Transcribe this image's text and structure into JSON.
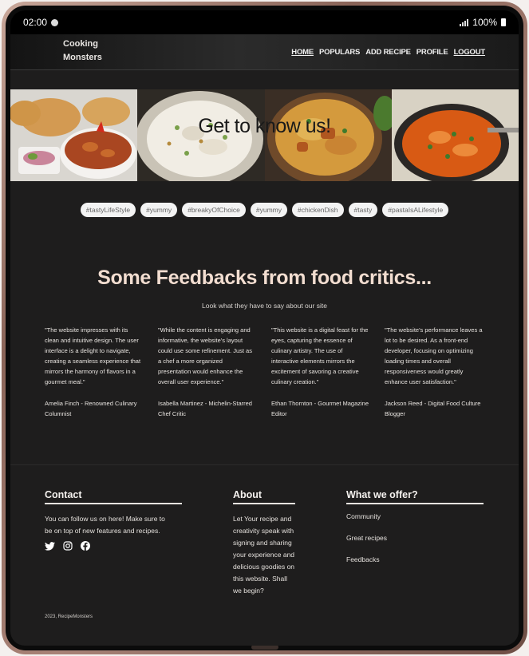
{
  "status": {
    "time": "02:00",
    "battery": "100%"
  },
  "brand": {
    "line1": "Cooking",
    "line2": "Monsters"
  },
  "nav": [
    {
      "label": "HOME"
    },
    {
      "label": "POPULARS"
    },
    {
      "label": "ADD RECIPE"
    },
    {
      "label": "PROFILE"
    },
    {
      "label": "LOGOUT"
    }
  ],
  "banner": {
    "title": "Get to know us!"
  },
  "tags": [
    "#tastyLifeStyle",
    "#yummy",
    "#breakyOfChoice",
    "#yummy",
    "#chickenDish",
    "#tasty",
    "#pastaIsALifestyle"
  ],
  "feedback": {
    "title": "Some Feedbacks from food critics...",
    "subtitle": "Look what they have to say about our site",
    "reviews": [
      {
        "quote": "\"The website impresses with its clean and intuitive design. The user interface is a delight to navigate, creating a seamless experience that mirrors the harmony of flavors in a gourmet meal.\"",
        "author": "Amelia Finch - Renowned Culinary Columnist"
      },
      {
        "quote": "\"While the content is engaging and informative, the website's layout could use some refinement. Just as a chef a more organized presentation would enhance the overall user experience.\"",
        "author": "Isabella Martinez - Michelin-Starred Chef Critic"
      },
      {
        "quote": "\"This website is a digital feast for the eyes, capturing the essence of culinary artistry. The use of interactive elements mirrors the excitement of savoring a creative culinary creation.\"",
        "author": "Ethan Thornton - Gourmet Magazine Editor"
      },
      {
        "quote": "\"The website's performance leaves a lot to be desired. As a front-end developer, focusing on optimizing loading times and overall responsiveness would greatly enhance user satisfaction.\"",
        "author": "Jackson Reed - Digital Food Culture Blogger"
      }
    ]
  },
  "footer": {
    "contact": {
      "title": "Contact",
      "text": "You can follow us on here! Make sure to be on top of new features and recipes.",
      "icons": [
        "twitter-icon",
        "instagram-icon",
        "facebook-icon"
      ]
    },
    "about": {
      "title": "About",
      "text": "Let Your recipe and creativity speak with signing and sharing your experience and delicious goodies on this website. Shall we begin?"
    },
    "offer": {
      "title": "What we offer?",
      "items": [
        "Community",
        "Great recipes",
        "Feedbacks"
      ]
    },
    "copyright": "2023, RecipeMonsters"
  },
  "colors": {
    "accent": "#f2ddd0",
    "background": "#1e1d1d",
    "tag_bg": "#f3f3f3"
  }
}
